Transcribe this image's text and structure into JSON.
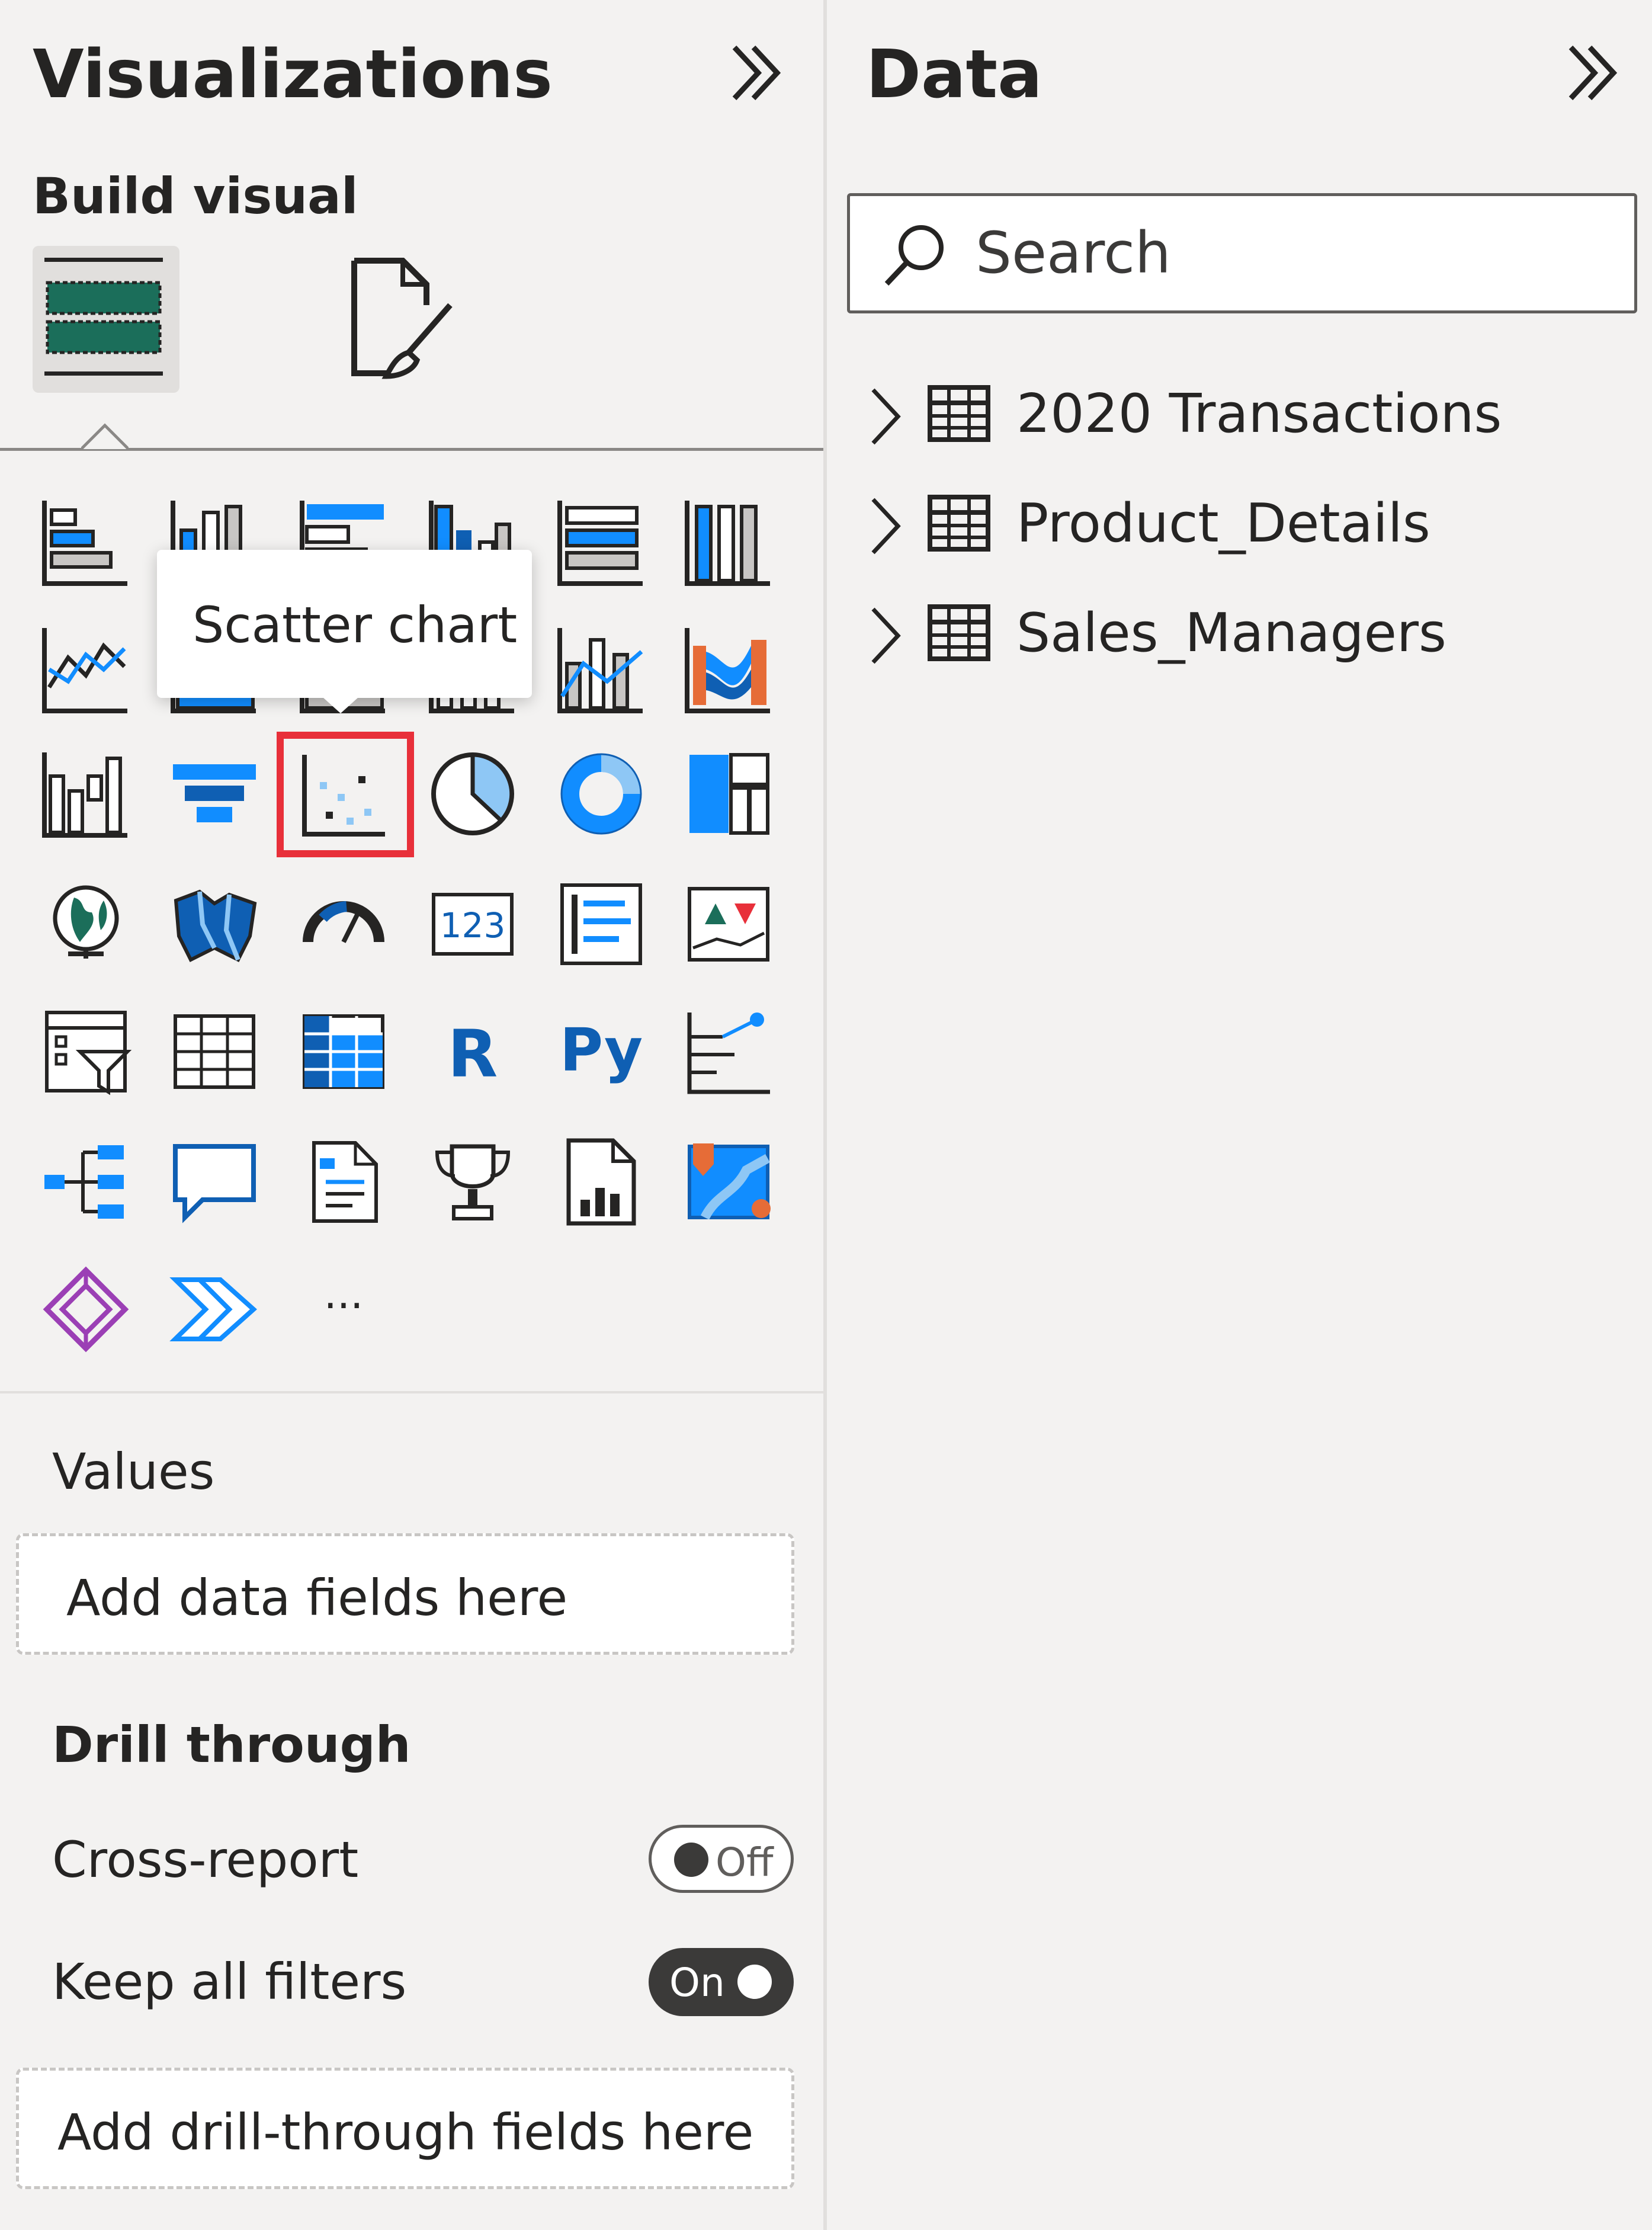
{
  "visualizations": {
    "title": "Visualizations",
    "subtitle": "Build visual",
    "tooltip": "Scatter chart",
    "icons": [
      [
        "stacked-bar-chart",
        "stacked-column-chart",
        "clustered-bar-chart",
        "clustered-column-chart",
        "100-stacked-bar-chart",
        "100-stacked-column-chart"
      ],
      [
        "line-chart",
        "area-chart",
        "stacked-area-chart",
        "line-and-stacked-column-chart",
        "line-and-clustered-column-chart",
        "ribbon-chart"
      ],
      [
        "waterfall-chart",
        "funnel-chart",
        "scatter-chart",
        "pie-chart",
        "donut-chart",
        "treemap"
      ],
      [
        "map",
        "filled-map",
        "gauge",
        "card",
        "multi-row-card",
        "kpi"
      ],
      [
        "slicer",
        "table",
        "matrix",
        "r-script-visual",
        "python-visual",
        "key-influencers"
      ],
      [
        "decomposition-tree",
        "qa-visual",
        "smart-narrative",
        "metrics",
        "paginated-report",
        "azure-map"
      ],
      [
        "power-apps",
        "power-automate",
        "more-visuals"
      ]
    ],
    "r_label": "R",
    "py_label": "Py",
    "card_label": "123",
    "more_label": "···",
    "values_label": "Values",
    "values_placeholder": "Add data fields here",
    "drill_label": "Drill through",
    "cross_report_label": "Cross-report",
    "cross_report_state": "Off",
    "keep_filters_label": "Keep all filters",
    "keep_filters_state": "On",
    "drill_placeholder": "Add drill-through fields here"
  },
  "data_pane": {
    "title": "Data",
    "search_placeholder": "Search",
    "tables": [
      "2020 Transactions",
      "Product_Details",
      "Sales_Managers"
    ]
  },
  "colors": {
    "accent_blue": "#118dff",
    "dark_blue": "#0f5fb3",
    "light_blue": "#8ec7f5",
    "selection_red": "#e8303a",
    "build_green": "#1b6e5a",
    "orange": "#e66c37",
    "purple": "#9b3fb5"
  }
}
